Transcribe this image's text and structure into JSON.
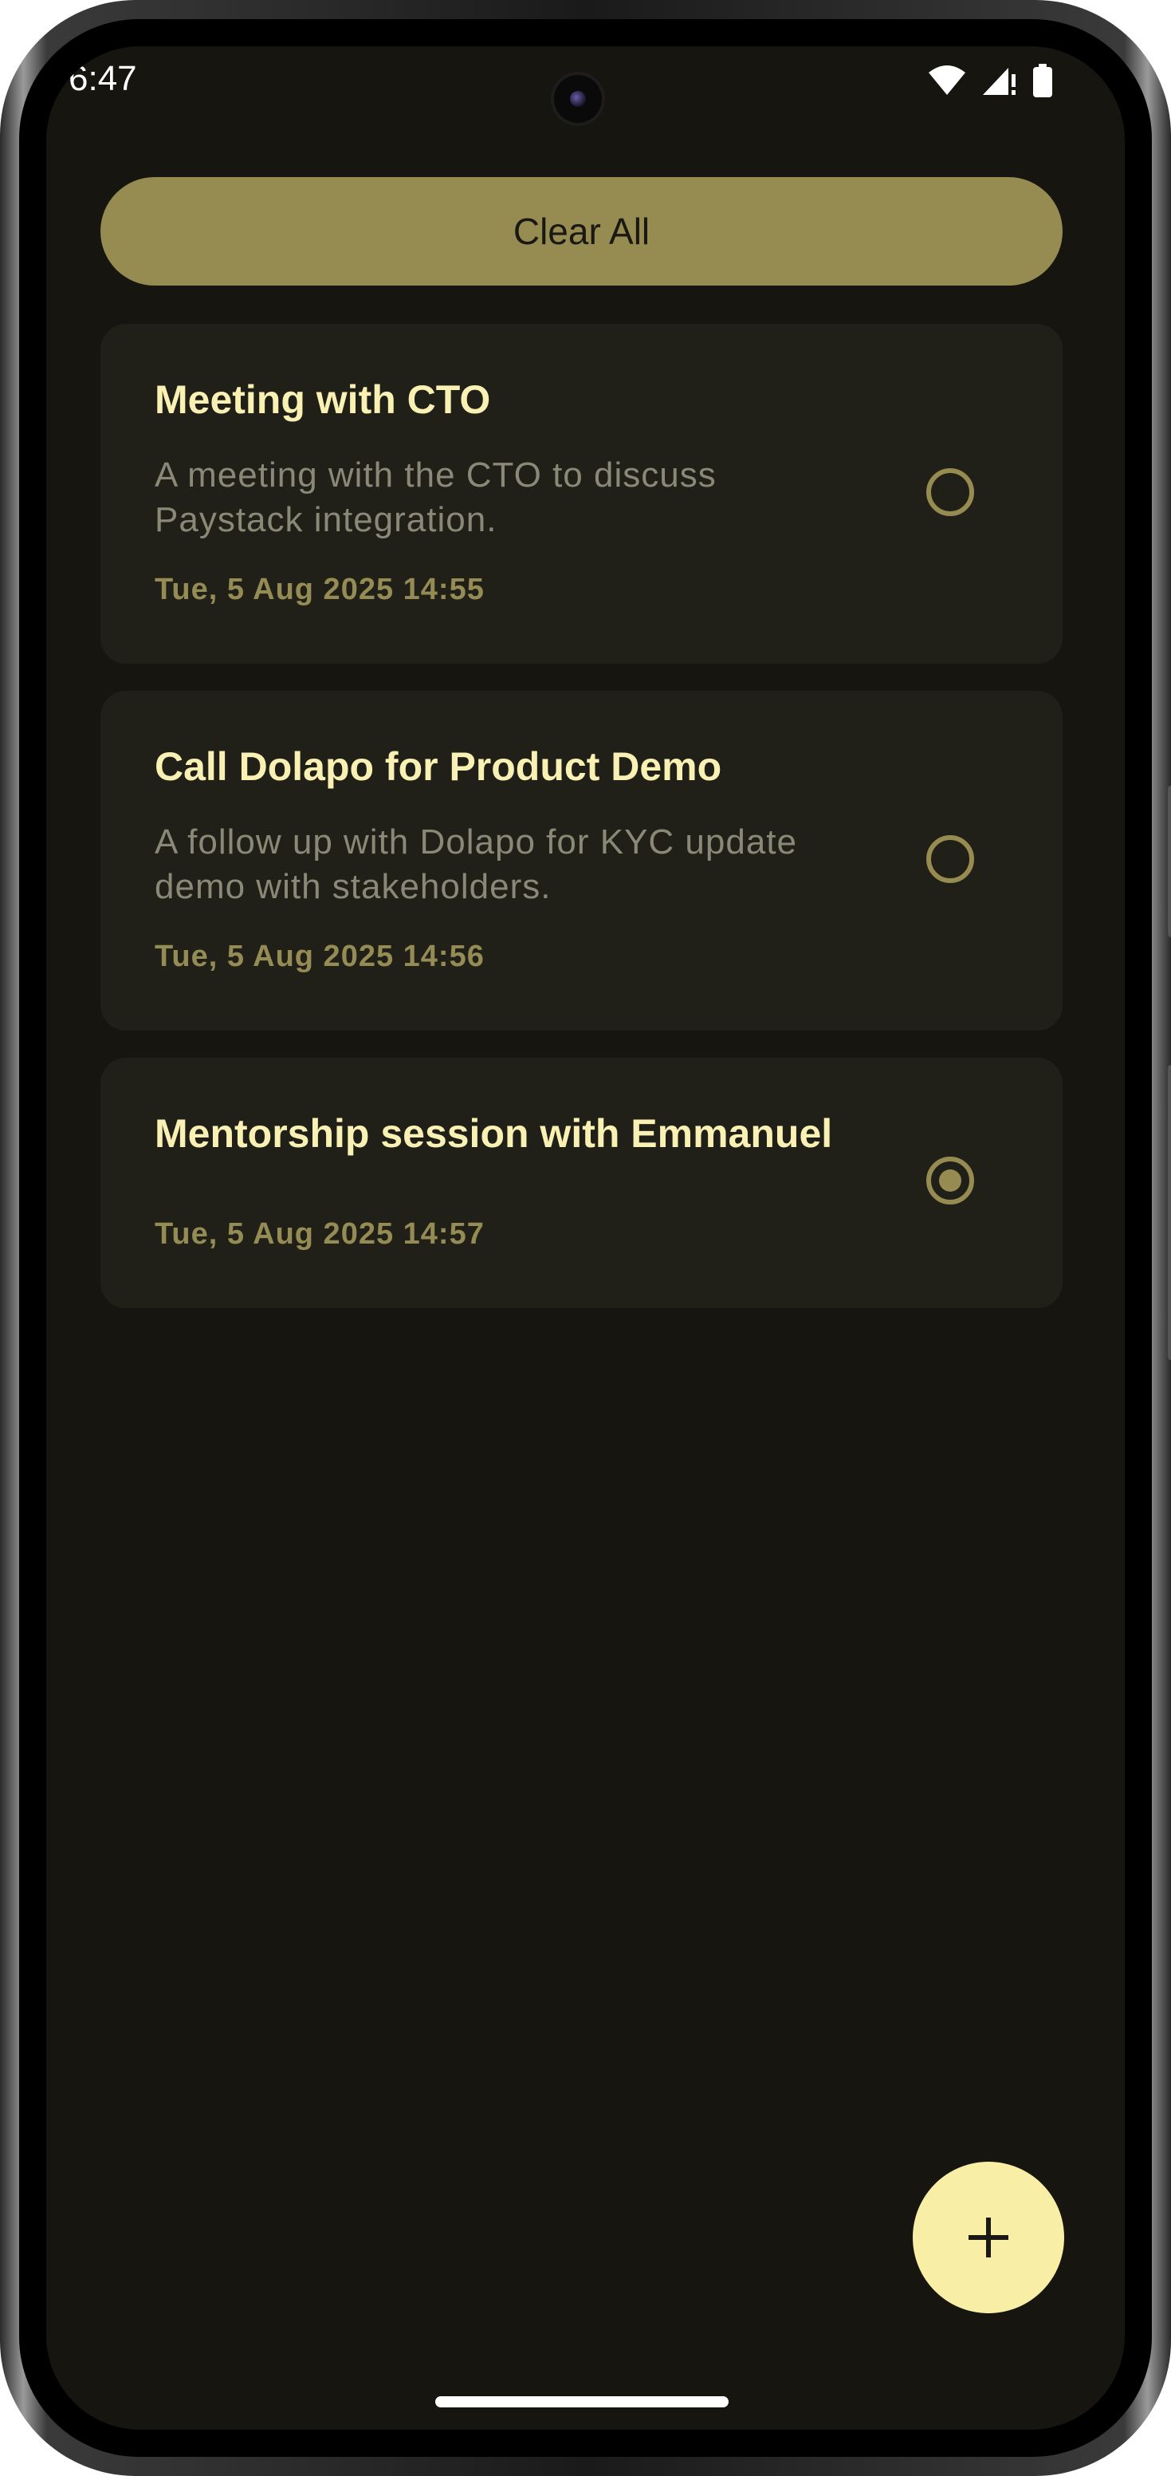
{
  "status_bar": {
    "time": "6:47",
    "icons": [
      "wifi-icon",
      "signal-icon",
      "battery-icon"
    ]
  },
  "toolbar": {
    "clear_all_label": "Clear All"
  },
  "tasks": [
    {
      "title": "Meeting with CTO",
      "description": "A meeting with the CTO to discuss Paystack integration.",
      "date": "Tue, 5 Aug 2025 14:55",
      "completed": false
    },
    {
      "title": "Call Dolapo for Product Demo",
      "description": "A follow up with Dolapo for KYC update demo with stakeholders.",
      "date": "Tue, 5 Aug 2025 14:56",
      "completed": false
    },
    {
      "title": "Mentorship session with Emmanuel",
      "description": "",
      "date": "Tue, 5 Aug 2025 14:57",
      "completed": true
    }
  ],
  "fab": {
    "icon": "plus-icon"
  },
  "colors": {
    "background": "#16150f",
    "card": "#212018",
    "accent": "#968c51",
    "title": "#f9f0b4",
    "fab": "#f8eea6"
  }
}
